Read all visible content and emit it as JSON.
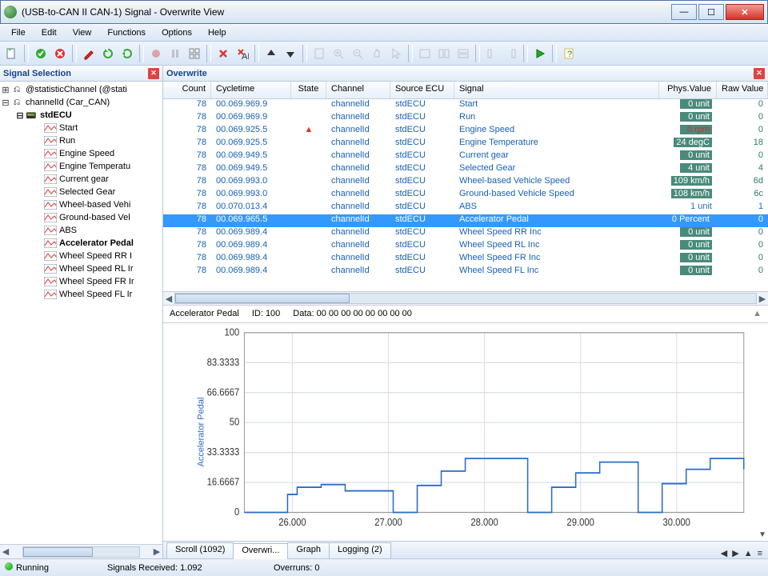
{
  "window": {
    "title": "(USB-to-CAN II  CAN-1) Signal - Overwrite View"
  },
  "menu": {
    "items": [
      "File",
      "Edit",
      "View",
      "Functions",
      "Options",
      "Help"
    ]
  },
  "sidebar": {
    "title": "Signal Selection",
    "root1": "@statisticChannel  (@stati",
    "root2": "channelId  (Car_CAN)",
    "ecu": "stdECU",
    "signals": [
      "Start",
      "Run",
      "Engine Speed",
      "Engine Temperatu",
      "Current gear",
      "Selected Gear",
      "Wheel-based Vehi",
      "Ground-based Vel",
      "ABS",
      "Accelerator Pedal",
      "Wheel Speed RR I",
      "Wheel Speed RL Ir",
      "Wheel Speed FR Ir",
      "Wheel Speed FL Ir"
    ]
  },
  "overwrite": {
    "title": "Overwrite",
    "headers": {
      "count": "Count",
      "cycle": "Cycletime",
      "state": "State",
      "chan": "Channel",
      "ecu": "Source ECU",
      "sig": "Signal",
      "pv": "Phys.Value",
      "rv": "Raw Value"
    },
    "rows": [
      {
        "count": "78",
        "cycle": "00.069.969.9",
        "state": "",
        "chan": "channelId",
        "ecu": "stdECU",
        "sig": "Start",
        "pv": "0 unit",
        "rv": "0"
      },
      {
        "count": "78",
        "cycle": "00.069.969.9",
        "state": "",
        "chan": "channelId",
        "ecu": "stdECU",
        "sig": "Run",
        "pv": "0 unit",
        "rv": "0"
      },
      {
        "count": "78",
        "cycle": "00.069.925.5",
        "state": "⯅",
        "chan": "channelId",
        "ecu": "stdECU",
        "sig": "Engine Speed",
        "pv": "0 rpm",
        "rv": "0",
        "red": true
      },
      {
        "count": "78",
        "cycle": "00.069.925.5",
        "state": "",
        "chan": "channelId",
        "ecu": "stdECU",
        "sig": "Engine Temperature",
        "pv": "24 degC",
        "rv": "18"
      },
      {
        "count": "78",
        "cycle": "00.069.949.5",
        "state": "",
        "chan": "channelId",
        "ecu": "stdECU",
        "sig": "Current gear",
        "pv": "0 unit",
        "rv": "0"
      },
      {
        "count": "78",
        "cycle": "00.069.949.5",
        "state": "",
        "chan": "channelId",
        "ecu": "stdECU",
        "sig": "Selected Gear",
        "pv": "4 unit",
        "rv": "4"
      },
      {
        "count": "78",
        "cycle": "00.069.993.0",
        "state": "",
        "chan": "channelId",
        "ecu": "stdECU",
        "sig": "Wheel-based Vehicle Speed",
        "pv": "109 km/h",
        "rv": "6d"
      },
      {
        "count": "78",
        "cycle": "00.069.993.0",
        "state": "",
        "chan": "channelId",
        "ecu": "stdECU",
        "sig": "Ground-based Vehicle Speed",
        "pv": "108 km/h",
        "rv": "6c"
      },
      {
        "count": "78",
        "cycle": "00.070.013.4",
        "state": "",
        "chan": "channelId",
        "ecu": "stdECU",
        "sig": "ABS",
        "pv": "1 unit",
        "rv": "1",
        "plain": true
      },
      {
        "count": "78",
        "cycle": "00.069.965.5",
        "state": "",
        "chan": "channelId",
        "ecu": "stdECU",
        "sig": "Accelerator Pedal",
        "pv": "0 Percent",
        "rv": "0",
        "sel": true
      },
      {
        "count": "78",
        "cycle": "00.069.989.4",
        "state": "",
        "chan": "channelId",
        "ecu": "stdECU",
        "sig": "Wheel Speed RR Inc",
        "pv": "0 unit",
        "rv": "0"
      },
      {
        "count": "78",
        "cycle": "00.069.989.4",
        "state": "",
        "chan": "channelId",
        "ecu": "stdECU",
        "sig": "Wheel Speed RL Inc",
        "pv": "0 unit",
        "rv": "0"
      },
      {
        "count": "78",
        "cycle": "00.069.989.4",
        "state": "",
        "chan": "channelId",
        "ecu": "stdECU",
        "sig": "Wheel Speed FR Inc",
        "pv": "0 unit",
        "rv": "0"
      },
      {
        "count": "78",
        "cycle": "00.069.989.4",
        "state": "",
        "chan": "channelId",
        "ecu": "stdECU",
        "sig": "Wheel Speed FL Inc",
        "pv": "0 unit",
        "rv": "0"
      }
    ]
  },
  "detail": {
    "name": "Accelerator Pedal",
    "id": "ID: 100",
    "data": "Data:   00 00 00 00 00 00 00 00"
  },
  "tabs": {
    "items": [
      "Scroll (1092)",
      "Overwri...",
      "Graph",
      "Logging (2)"
    ],
    "active": 1
  },
  "status": {
    "state": "Running",
    "recv": "Signals Received: 1.092",
    "over": "Overruns: 0"
  },
  "chart_data": {
    "type": "line",
    "title": "",
    "xlabel": "",
    "ylabel": "Accelerator Pedal",
    "ylim": [
      0,
      100
    ],
    "yticks": [
      0,
      16.6667,
      33.3333,
      50,
      66.6667,
      83.3333,
      100
    ],
    "xlim": [
      25.5,
      30.7
    ],
    "xticks": [
      26.0,
      27.0,
      28.0,
      29.0,
      30.0
    ],
    "series": [
      {
        "name": "Accelerator Pedal",
        "color": "#2a6bc5",
        "x": [
          25.5,
          25.9,
          25.95,
          26.0,
          26.05,
          26.25,
          26.3,
          26.5,
          26.55,
          26.75,
          27.05,
          27.1,
          27.3,
          27.35,
          27.55,
          27.6,
          27.8,
          27.85,
          28.05,
          28.25,
          28.45,
          28.5,
          28.7,
          28.75,
          28.95,
          29.0,
          29.2,
          29.4,
          29.6,
          29.65,
          29.85,
          29.9,
          30.1,
          30.15,
          30.35,
          30.55,
          30.7
        ],
        "y": [
          0,
          0,
          10,
          10,
          14,
          14,
          15.5,
          15.5,
          12,
          12,
          0,
          0,
          15,
          15,
          23,
          23,
          30,
          30,
          30,
          30,
          0,
          0,
          14,
          14,
          22,
          22,
          28,
          28,
          0,
          0,
          16,
          16,
          24,
          24,
          30,
          30,
          24
        ]
      }
    ]
  }
}
